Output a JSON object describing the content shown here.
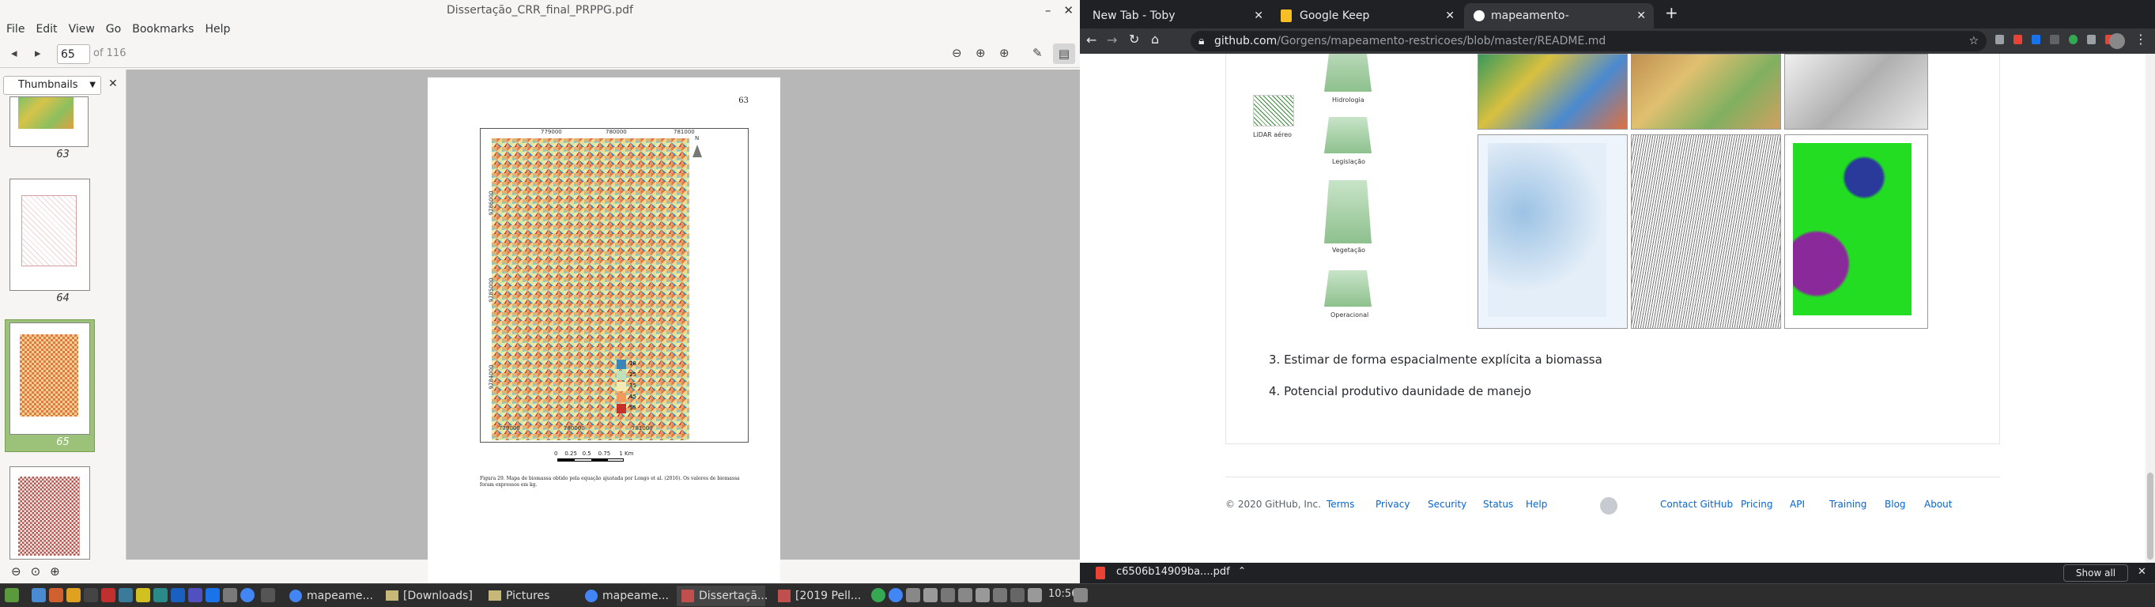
{
  "pdf": {
    "title": "Dissertação_CRR_final_PRPPG.pdf",
    "menu": [
      "File",
      "Edit",
      "View",
      "Go",
      "Bookmarks",
      "Help"
    ],
    "page_current": "65",
    "page_total": "of 116",
    "sidebar_mode": "Thumbnails",
    "thumbnails": [
      {
        "label": "63"
      },
      {
        "label": "64"
      },
      {
        "label": "65"
      }
    ],
    "page_number": "63",
    "map": {
      "x_ticks": [
        "779000",
        "780000",
        "781000"
      ],
      "y_ticks": [
        "9784000",
        "9785000",
        "9786000"
      ],
      "legend_values": [
        "18",
        "25",
        "35",
        "45",
        "55"
      ],
      "scale_text": "0    0.25   0.5    0.75     1 Km",
      "caption": "Figura 29. Mapa de biomassa obtido pela equação ajustada por Longo et al. (2016). Os valores de biomassa foram expressos em kg."
    }
  },
  "chrome": {
    "tabs": [
      {
        "title": "New Tab - Toby"
      },
      {
        "title": "Google Keep"
      },
      {
        "title": "mapeamento-restricoes/READ"
      }
    ],
    "url_host": "github.com",
    "url_path": "/Gorgens/mapeamento-restricoes/blob/master/README.md",
    "diagram_labels": [
      "LiDAR aéreo",
      "Hidrologia",
      "Legislação",
      "Vegetação",
      "Operacional"
    ],
    "list_items": [
      "3. Estimar de forma espacialmente explícita a biomassa",
      "4. Potencial produtivo daunidade de manejo"
    ],
    "footer": {
      "copyright": "© 2020 GitHub, Inc.",
      "left_links": [
        "Terms",
        "Privacy",
        "Security",
        "Status",
        "Help"
      ],
      "right_links": [
        "Contact GitHub",
        "Pricing",
        "API",
        "Training",
        "Blog",
        "About"
      ]
    },
    "download": {
      "file": "c6506b14909ba....pdf",
      "show_all": "Show all"
    }
  },
  "taskbar": {
    "tasks": [
      "mapeame...",
      "[Downloads]",
      "Pictures",
      "mapeame...",
      "Dissertaçã...",
      "[2019 Pell..."
    ],
    "clock": "10:56"
  }
}
